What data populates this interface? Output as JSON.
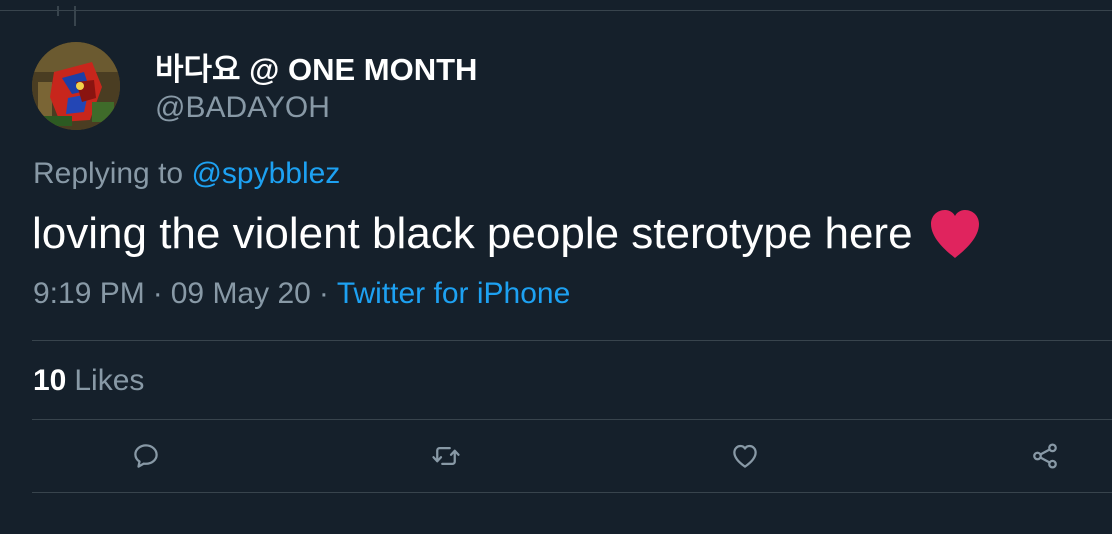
{
  "tweet": {
    "display_name": "바다요 @ ONE MONTH",
    "handle": "@BADAYOH",
    "replying_prefix": "Replying to",
    "replying_to": "@spybblez",
    "text": "loving the violent black people sterotype here",
    "emoji": "red-heart",
    "time": "9:19 PM",
    "date": "09 May 20",
    "separator": "·",
    "source": "Twitter for iPhone",
    "likes_count": "10",
    "likes_label": "Likes"
  },
  "actions": {
    "reply_icon": "comment-bubble-icon",
    "retweet_icon": "retweet-icon",
    "like_icon": "heart-outline-icon",
    "share_icon": "share-icon"
  },
  "colors": {
    "background": "#15202b",
    "divider": "#38444d",
    "secondary_text": "#8899a6",
    "link_blue": "#1da1f2",
    "primary_text": "#ffffff",
    "heart_red": "#e0245e"
  }
}
